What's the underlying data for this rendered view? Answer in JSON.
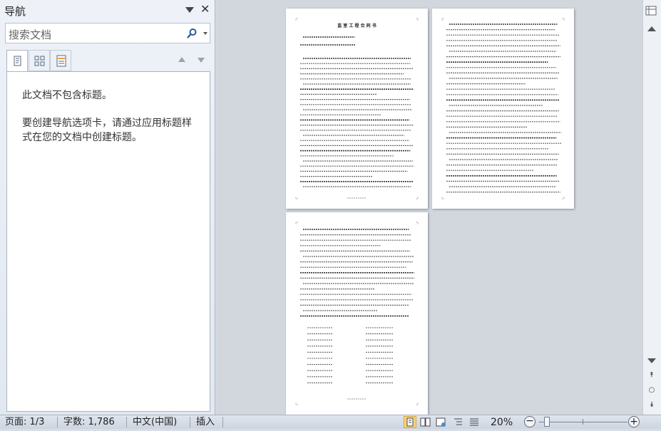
{
  "nav_pane": {
    "title": "导航",
    "search_placeholder": "搜索文档",
    "tabs": [
      {
        "icon": "headings-icon"
      },
      {
        "icon": "page-thumbnails-icon"
      },
      {
        "icon": "search-results-icon"
      }
    ],
    "message_no_headings": "此文档不包含标题。",
    "message_help": "要创建导航选项卡，请通过应用标题样式在您的文档中创建标题。"
  },
  "document": {
    "page_1_title": "监 室 工 程 合 同 书"
  },
  "status_bar": {
    "page": "页面: 1/3",
    "words": "字数: 1,786",
    "language": "中文(中国)",
    "mode": "插入",
    "zoom": "20%"
  },
  "colors": {
    "accent": "#f7d37b",
    "pane_bg": "#e8edf4",
    "workspace_bg": "#d2d7de"
  }
}
